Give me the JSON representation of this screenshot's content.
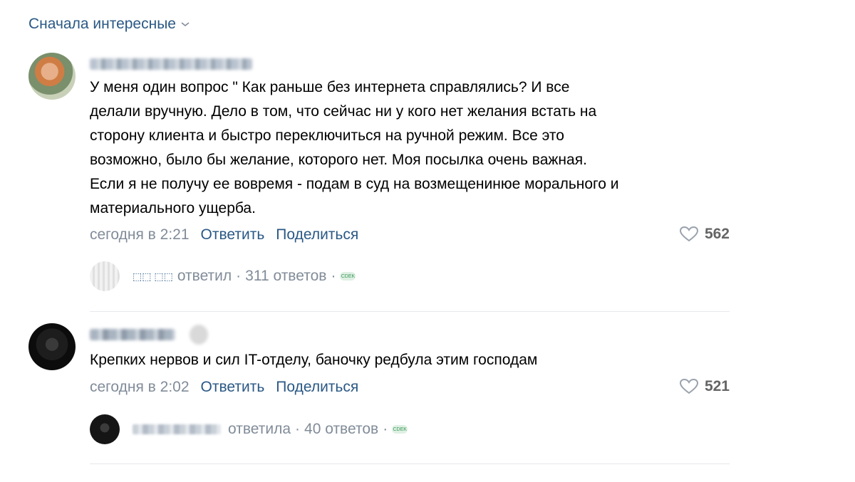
{
  "sort": {
    "label": "Сначала интересные"
  },
  "comments": [
    {
      "text": "У меня один вопрос \" Как раньше без интернета справлялись? И все\nделали вручную. Дело в том, что сейчас ни у кого нет желания встать на\nсторону клиента и быстро переключиться на ручной режим. Все это\nвозможно, было бы желание, которого нет. Моя посылка очень важная.\nЕсли я не получу ее вовремя - подам в суд на возмещенинюе морального и\nматериального ущерба.",
      "time": "сегодня в 2:21",
      "reply_label": "Ответить",
      "share_label": "Поделиться",
      "likes": "562",
      "thread": {
        "replier": "⬚⬚ ⬚⬚",
        "action": "ответил",
        "separator": "·",
        "count_label": "311 ответов",
        "badge": "CDEK"
      }
    },
    {
      "text": "Крепких нервов и сил IT-отделу, баночку редбула этим господам",
      "time": "сегодня в 2:02",
      "reply_label": "Ответить",
      "share_label": "Поделиться",
      "likes": "521",
      "thread": {
        "action": "ответила",
        "separator": "·",
        "count_label": "40 ответов",
        "badge": "CDEK"
      }
    }
  ],
  "colors": {
    "link": "#2a5885",
    "meta": "#818c99",
    "divider": "#e7e8ec"
  }
}
